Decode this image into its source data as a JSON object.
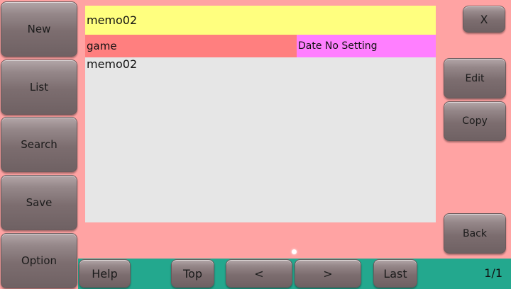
{
  "sidebar": {
    "new_label": "New",
    "list_label": "List",
    "search_label": "Search",
    "save_label": "Save",
    "option_label": "Option"
  },
  "memo": {
    "title": "memo02",
    "category": "game",
    "date": "Date No Setting",
    "body": "memo02"
  },
  "right_panel": {
    "close_label": "X",
    "edit_label": "Edit",
    "copy_label": "Copy",
    "back_label": "Back"
  },
  "bottom_bar": {
    "help_label": "Help",
    "top_label": "Top",
    "prev_label": "<",
    "next_label": ">",
    "last_label": "Last",
    "page_indicator": "1/1"
  },
  "colors": {
    "background": "#ffa3a3",
    "title_field": "#ffff7f",
    "category": "#ff7f7f",
    "date": "#ff7fff",
    "body": "#e6e6e6",
    "bottom_bar": "#23a88e"
  }
}
